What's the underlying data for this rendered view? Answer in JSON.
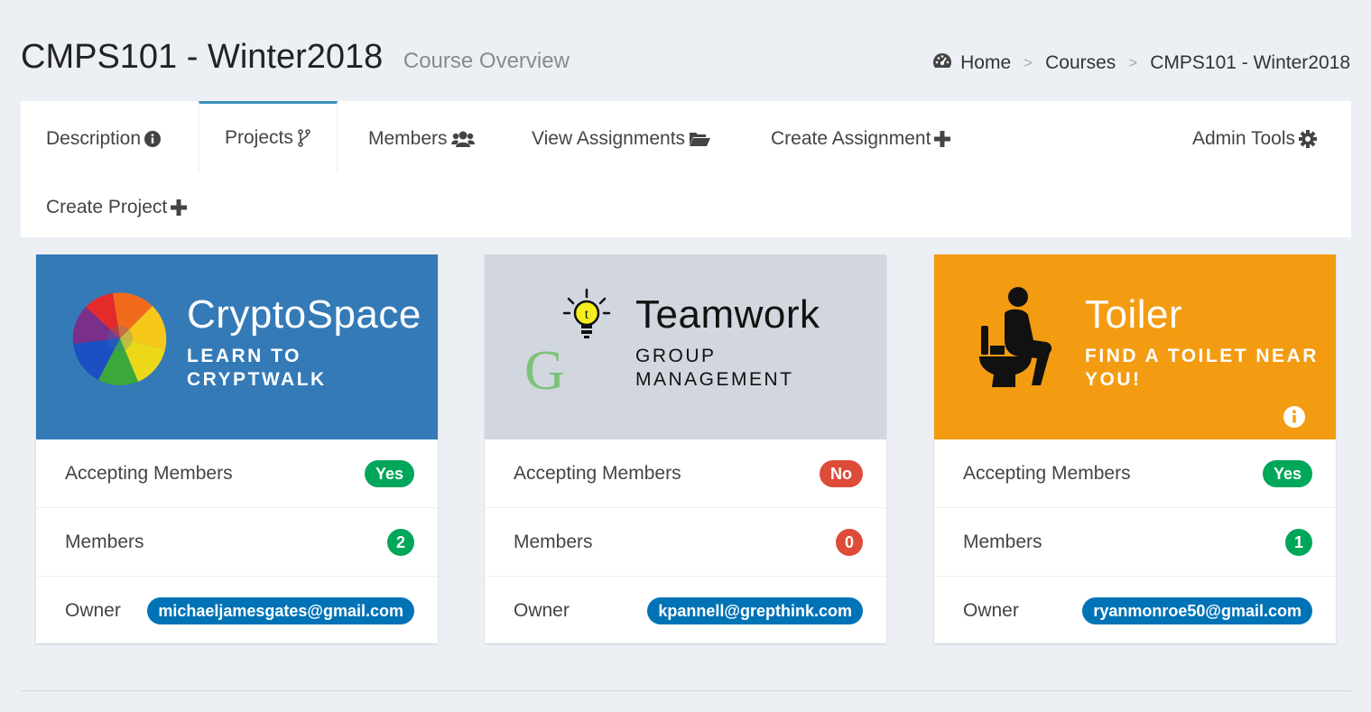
{
  "header": {
    "title": "CMPS101 - Winter2018",
    "subtitle": "Course Overview",
    "breadcrumb": [
      "Home",
      "Courses",
      "CMPS101 - Winter2018"
    ],
    "breadcrumb_icon": "dashboard-icon"
  },
  "tabs": [
    {
      "label": "Description",
      "icon": "info-circle-icon",
      "active": false
    },
    {
      "label": "Projects",
      "icon": "code-fork-icon",
      "active": true
    },
    {
      "label": "Members",
      "icon": "users-icon",
      "active": false
    },
    {
      "label": "View Assignments",
      "icon": "folder-open-icon",
      "active": false
    },
    {
      "label": "Create Assignment",
      "icon": "plus-icon",
      "active": false
    },
    {
      "label": "Admin Tools",
      "icon": "gear-icon",
      "active": false
    },
    {
      "label": "Create Project",
      "icon": "plus-icon",
      "active": false
    }
  ],
  "projects": [
    {
      "name": "CryptoSpace",
      "tagline": "Learn to Cryptwalk",
      "header_color": "#337ab7",
      "accepting_label": "Accepting Members",
      "accepting": "Yes",
      "members_label": "Members",
      "members": "2",
      "owner_label": "Owner",
      "owner": "michaeljamesgates@gmail.com"
    },
    {
      "name": "Teamwork",
      "tagline": "Group Management",
      "header_color": "#d2d6de",
      "accepting_label": "Accepting Members",
      "accepting": "No",
      "members_label": "Members",
      "members": "0",
      "owner_label": "Owner",
      "owner": "kpannell@grepthink.com"
    },
    {
      "name": "Toiler",
      "tagline": "Find a toilet near you!",
      "header_color": "#f39c12",
      "accepting_label": "Accepting Members",
      "accepting": "Yes",
      "members_label": "Members",
      "members": "1",
      "owner_label": "Owner",
      "owner": "ryanmonroe50@gmail.com"
    }
  ]
}
